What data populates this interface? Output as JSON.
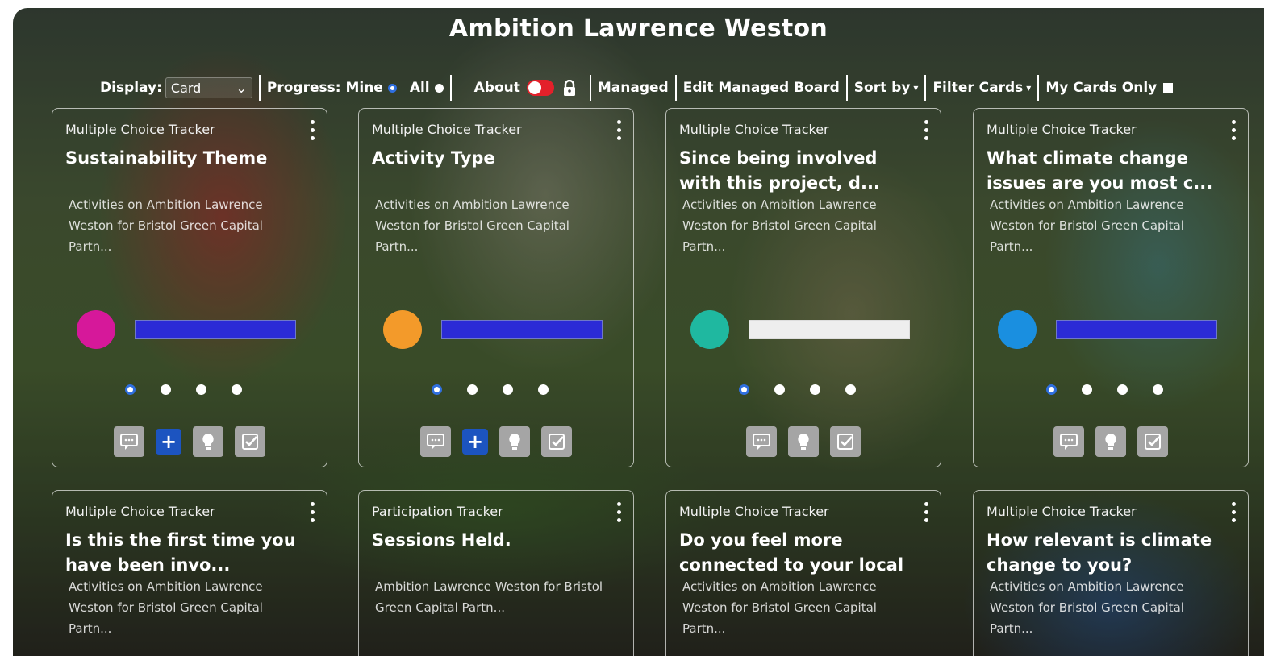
{
  "app": {
    "title": "Ambition Lawrence Weston"
  },
  "toolbar": {
    "display_label": "Display:",
    "display_value": "Card",
    "progress_label": "Progress: Mine",
    "all_label": "All",
    "about_label": "About",
    "managed_label": "Managed",
    "edit_label": "Edit Managed Board",
    "sort_label": "Sort by",
    "filter_label": "Filter Cards",
    "mycards_label": "My Cards Only"
  },
  "colors": {
    "progress_bar": "#2b2bd6",
    "progress_bar_empty": "#eeeeee",
    "accent": "#2f6fe0",
    "toggle": "#e4202a"
  },
  "cards": [
    {
      "type": "Multiple Choice Tracker",
      "title": "Sustainability Theme",
      "desc": "Activities on Ambition Lawrence Weston for Bristol Green Capital Partn...",
      "circle_color": "#d6189a",
      "bar_color": "#2b2bd6"
    },
    {
      "type": "Multiple Choice Tracker",
      "title": "Activity Type",
      "desc": "Activities on Ambition Lawrence Weston for Bristol Green Capital Partn...",
      "circle_color": "#f39a2a",
      "bar_color": "#2b2bd6"
    },
    {
      "type": "Multiple Choice Tracker",
      "title": "Since being involved with this project, d...",
      "desc": "Activities on Ambition Lawrence Weston for Bristol Green Capital Partn...",
      "circle_color": "#1fb8a0",
      "bar_color": "#eeeeee"
    },
    {
      "type": "Multiple Choice Tracker",
      "title": "What climate change issues are you most c...",
      "desc": "Activities on Ambition Lawrence Weston for Bristol Green Capital Partn...",
      "circle_color": "#1a8fe0",
      "bar_color": "#2b2bd6"
    },
    {
      "type": "Multiple Choice Tracker",
      "title": "Is this the first time you have been invo...",
      "desc": "Activities on Ambition Lawrence Weston for Bristol Green Capital Partn..."
    },
    {
      "type": "Participation Tracker",
      "title": "Sessions Held.",
      "desc": "Ambition Lawrence Weston for Bristol Green Capital Partn..."
    },
    {
      "type": "Multiple Choice Tracker",
      "title": "Do you feel more connected to your local",
      "desc": "Activities on Ambition Lawrence Weston for Bristol Green Capital Partn..."
    },
    {
      "type": "Multiple Choice Tracker",
      "title": "How relevant is climate change to you?",
      "desc": "Activities on Ambition Lawrence Weston for Bristol Green Capital Partn..."
    }
  ]
}
